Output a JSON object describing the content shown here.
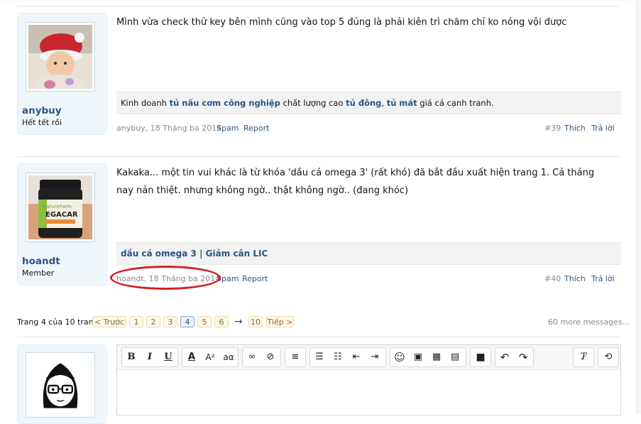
{
  "posts": [
    {
      "username": "anybuy",
      "user_title": "Hết tết rồi",
      "message": "Mình vừa check thử key bên mình cũng vào top 5 đúng là phải kiên trì chăm chỉ ko nóng vội được",
      "signature": {
        "t1": "Kinh doanh ",
        "l1": "tủ nấu cơm công nghiệp",
        "t2": " chất lượng cao ",
        "l2": "tủ đông",
        "t3": ", ",
        "l3": "tủ mát",
        "t4": " giá cả cạnh tranh."
      },
      "date": "anybuy, 18 Tháng ba 2014",
      "spam": "Spam",
      "report": "Report",
      "number": "#39",
      "like": "Thích",
      "reply": "Trả lời"
    },
    {
      "username": "hoandt",
      "user_title": "Member",
      "message": "Kakaka... một tin vui khác là từ khóa 'dầu cá omega 3' (rất khó) đã bắt đầu xuất hiện trang 1. Cả tháng nay nản thiệt. nhưng không ngờ.. thật không ngờ.. (đang khóc)",
      "signature": {
        "l1": "dầu cá omega 3",
        "sep": " | ",
        "l2": "Giảm cân LIC"
      },
      "date": "hoandt, 18 Tháng ba 2014",
      "spam": "Spam",
      "report": "Report",
      "number": "#40",
      "like": "Thích",
      "reply": "Trả lời"
    }
  ],
  "pagination": {
    "label": "Trang 4 của 10 trang",
    "prev": "< Trước",
    "pages": [
      "1",
      "2",
      "3",
      "4",
      "5",
      "6"
    ],
    "current": "4",
    "arrow": "→",
    "last": "10",
    "next": "Tiếp >",
    "more": "60 more messages..."
  },
  "editor_toolbar_icons": [
    "bold-icon",
    "italic-icon",
    "underline-icon",
    "text-color-icon",
    "font-size-icon",
    "font-family-icon",
    "link-icon",
    "unlink-icon",
    "align-icon",
    "bullet-list-icon",
    "numbered-list-icon",
    "outdent-icon",
    "indent-icon",
    "smiley-icon",
    "image-icon",
    "media-icon",
    "quote-icon",
    "save-icon",
    "undo-icon",
    "redo-icon",
    "remove-format-icon",
    "toggle-bbcode-icon"
  ],
  "colors": {
    "link": "#2b5485",
    "annotation": "#d42020"
  }
}
